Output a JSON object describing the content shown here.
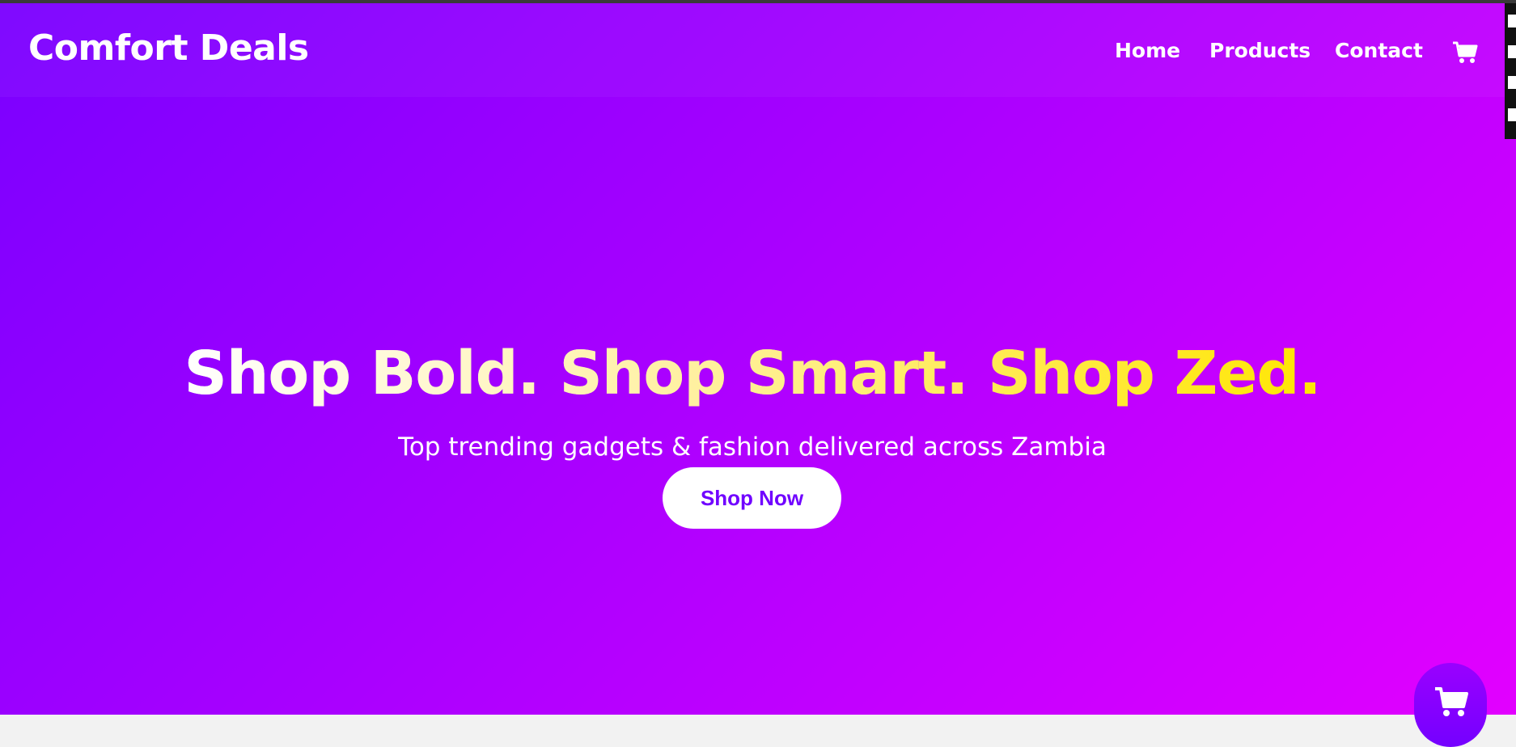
{
  "header": {
    "brand": "Comfort Deals",
    "nav": {
      "home": "Home",
      "products": "Products",
      "contact": "Contact"
    },
    "cart_icon": "cart-icon"
  },
  "hero": {
    "headline": "Shop Bold. Shop Smart. Shop Zed.",
    "subtitle": "Top trending gadgets & fashion delivered across Zambia",
    "cta_label": "Shop Now"
  },
  "floating_cart": {
    "icon": "cart-icon"
  },
  "colors": {
    "gradient_start": "#7a00ff",
    "gradient_end": "#e200ff",
    "headline_accent": "#ffe600",
    "cta_text": "#7000ff"
  }
}
